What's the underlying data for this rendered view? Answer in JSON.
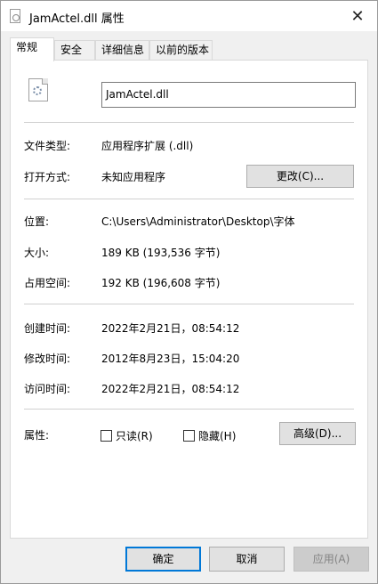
{
  "window": {
    "title": "JamActel.dll 属性",
    "close_glyph": "✕"
  },
  "tabs": [
    {
      "label": "常规",
      "active": true
    },
    {
      "label": "安全",
      "active": false
    },
    {
      "label": "详细信息",
      "active": false
    },
    {
      "label": "以前的版本",
      "active": false
    }
  ],
  "general": {
    "file_name": "JamActel.dll",
    "file_type_label": "文件类型:",
    "file_type_value": "应用程序扩展 (.dll)",
    "opens_with_label": "打开方式:",
    "opens_with_value": "未知应用程序",
    "change_button": "更改(C)...",
    "location_label": "位置:",
    "location_value": "C:\\Users\\Administrator\\Desktop\\字体",
    "size_label": "大小:",
    "size_value": "189 KB (193,536 字节)",
    "size_on_disk_label": "占用空间:",
    "size_on_disk_value": "192 KB (196,608 字节)",
    "created_label": "创建时间:",
    "created_value": "2022年2月21日，08:54:12",
    "modified_label": "修改时间:",
    "modified_value": "2012年8月23日，15:04:20",
    "accessed_label": "访问时间:",
    "accessed_value": "2022年2月21日，08:54:12",
    "attributes_label": "属性:",
    "readonly_label": "只读(R)",
    "readonly_checked": false,
    "hidden_label": "隐藏(H)",
    "hidden_checked": false,
    "advanced_button": "高级(D)..."
  },
  "footer": {
    "ok": "确定",
    "cancel": "取消",
    "apply": "应用(A)"
  },
  "colors": {
    "accent": "#0078d7",
    "panel": "#ffffff",
    "window_bg": "#f0f0f0"
  }
}
